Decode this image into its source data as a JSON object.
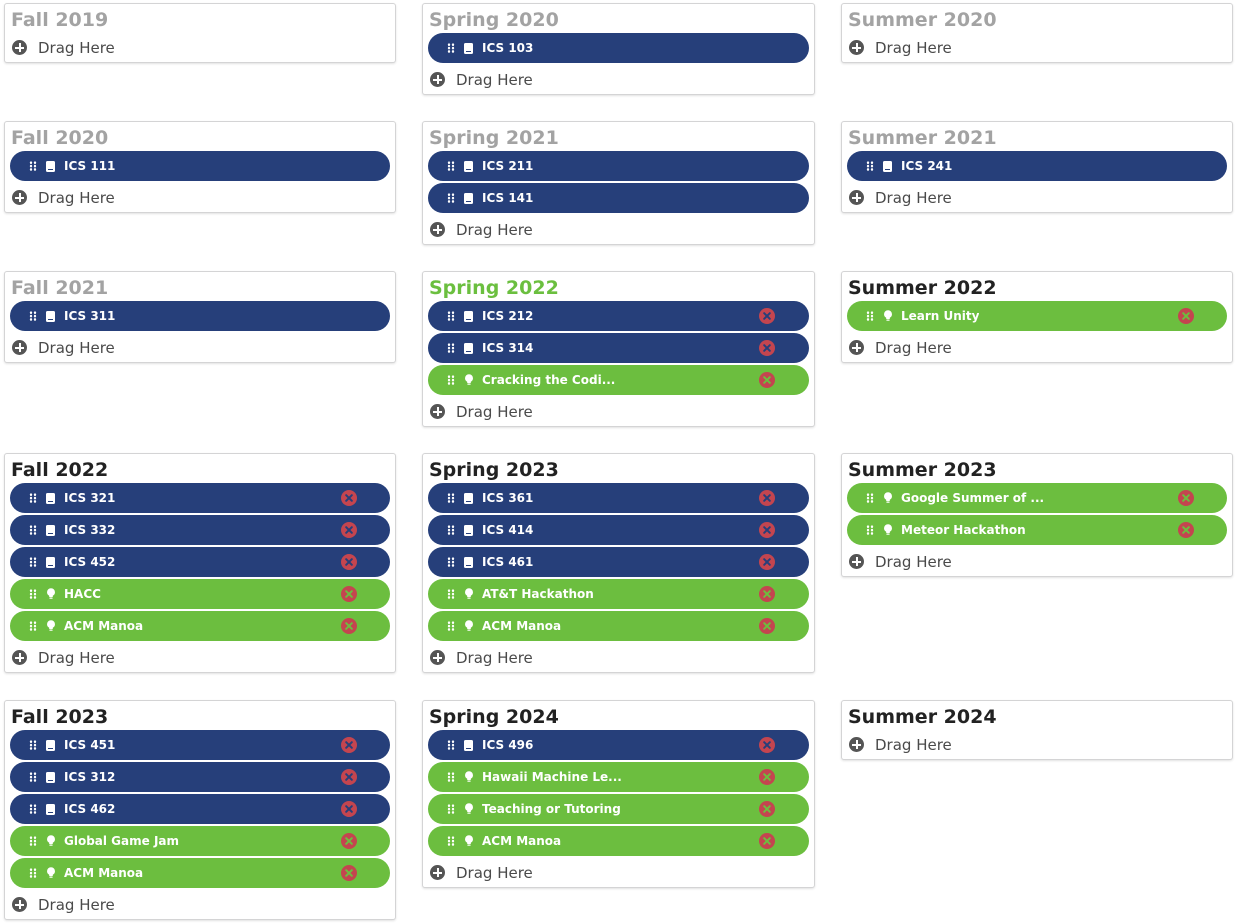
{
  "drag_label": "Drag Here",
  "colors": {
    "course": "#263f7a",
    "opportunity": "#6cbe3f",
    "current_term": "#6bbf3f",
    "past_term": "#a3a3a3",
    "remove": "#c4454f"
  },
  "terms": [
    {
      "name": "Fall 2019",
      "status": "past",
      "items": []
    },
    {
      "name": "Spring 2020",
      "status": "past",
      "items": [
        {
          "label": "ICS 103",
          "type": "course",
          "removable": false
        }
      ]
    },
    {
      "name": "Summer 2020",
      "status": "past",
      "items": []
    },
    {
      "name": "Fall 2020",
      "status": "past",
      "items": [
        {
          "label": "ICS 111",
          "type": "course",
          "removable": false
        }
      ]
    },
    {
      "name": "Spring 2021",
      "status": "past",
      "items": [
        {
          "label": "ICS 211",
          "type": "course",
          "removable": false
        },
        {
          "label": "ICS 141",
          "type": "course",
          "removable": false
        }
      ]
    },
    {
      "name": "Summer 2021",
      "status": "past",
      "items": [
        {
          "label": "ICS 241",
          "type": "course",
          "removable": false
        }
      ]
    },
    {
      "name": "Fall 2021",
      "status": "past",
      "items": [
        {
          "label": "ICS 311",
          "type": "course",
          "removable": false
        }
      ]
    },
    {
      "name": "Spring 2022",
      "status": "current",
      "items": [
        {
          "label": "ICS 212",
          "type": "course",
          "removable": true
        },
        {
          "label": "ICS 314",
          "type": "course",
          "removable": true
        },
        {
          "label": "Cracking the Codi...",
          "type": "opportunity",
          "removable": true
        }
      ]
    },
    {
      "name": "Summer 2022",
      "status": "future",
      "items": [
        {
          "label": "Learn Unity",
          "type": "opportunity",
          "removable": true
        }
      ]
    },
    {
      "name": "Fall 2022",
      "status": "future",
      "items": [
        {
          "label": "ICS 321",
          "type": "course",
          "removable": true
        },
        {
          "label": "ICS 332",
          "type": "course",
          "removable": true
        },
        {
          "label": "ICS 452",
          "type": "course",
          "removable": true
        },
        {
          "label": "HACC",
          "type": "opportunity",
          "removable": true
        },
        {
          "label": "ACM Manoa",
          "type": "opportunity",
          "removable": true
        }
      ]
    },
    {
      "name": "Spring 2023",
      "status": "future",
      "items": [
        {
          "label": "ICS 361",
          "type": "course",
          "removable": true
        },
        {
          "label": "ICS 414",
          "type": "course",
          "removable": true
        },
        {
          "label": "ICS 461",
          "type": "course",
          "removable": true
        },
        {
          "label": "AT&T Hackathon",
          "type": "opportunity",
          "removable": true
        },
        {
          "label": "ACM Manoa",
          "type": "opportunity",
          "removable": true
        }
      ]
    },
    {
      "name": "Summer 2023",
      "status": "future",
      "items": [
        {
          "label": "Google Summer of ...",
          "type": "opportunity",
          "removable": true
        },
        {
          "label": "Meteor Hackathon",
          "type": "opportunity",
          "removable": true
        }
      ]
    },
    {
      "name": "Fall 2023",
      "status": "future",
      "items": [
        {
          "label": "ICS 451",
          "type": "course",
          "removable": true
        },
        {
          "label": "ICS 312",
          "type": "course",
          "removable": true
        },
        {
          "label": "ICS 462",
          "type": "course",
          "removable": true
        },
        {
          "label": "Global Game Jam",
          "type": "opportunity",
          "removable": true
        },
        {
          "label": "ACM Manoa",
          "type": "opportunity",
          "removable": true
        }
      ]
    },
    {
      "name": "Spring 2024",
      "status": "future",
      "items": [
        {
          "label": "ICS 496",
          "type": "course",
          "removable": true
        },
        {
          "label": "Hawaii Machine Le...",
          "type": "opportunity",
          "removable": true
        },
        {
          "label": "Teaching or Tutoring",
          "type": "opportunity",
          "removable": true
        },
        {
          "label": "ACM Manoa",
          "type": "opportunity",
          "removable": true
        }
      ]
    },
    {
      "name": "Summer 2024",
      "status": "future",
      "items": []
    }
  ]
}
